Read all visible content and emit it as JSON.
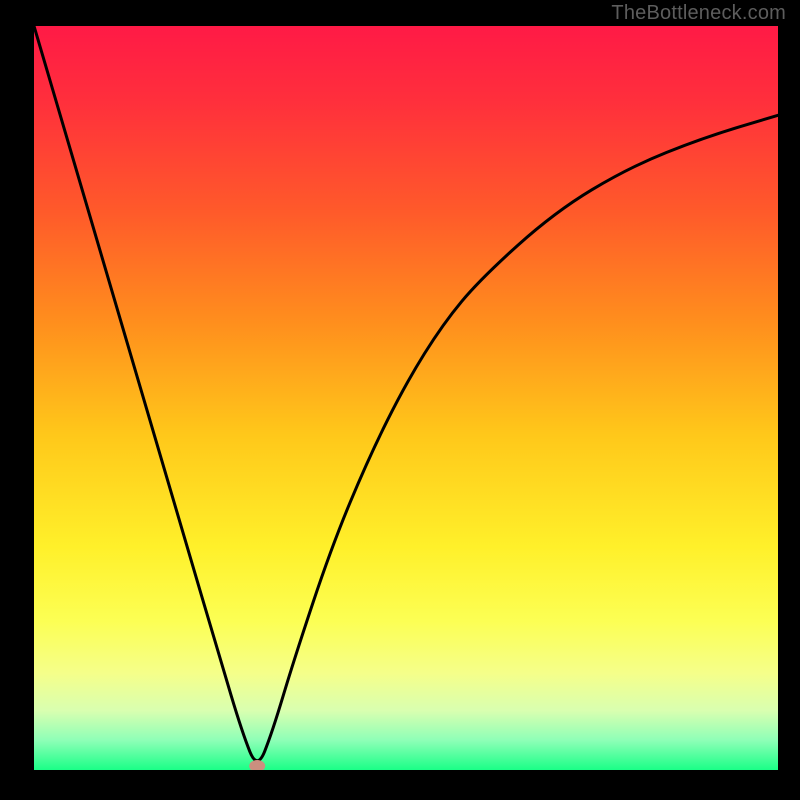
{
  "watermark": "TheBottleneck.com",
  "chart_data": {
    "type": "line",
    "title": "",
    "xlabel": "",
    "ylabel": "",
    "xlim": [
      0,
      1
    ],
    "ylim": [
      0,
      1
    ],
    "x": [
      0.0,
      0.05,
      0.1,
      0.15,
      0.2,
      0.25,
      0.28,
      0.3,
      0.32,
      0.35,
      0.4,
      0.45,
      0.5,
      0.55,
      0.6,
      0.7,
      0.8,
      0.9,
      1.0
    ],
    "values": [
      1.0,
      0.83,
      0.66,
      0.49,
      0.32,
      0.15,
      0.05,
      0.0,
      0.05,
      0.15,
      0.3,
      0.42,
      0.52,
      0.6,
      0.66,
      0.75,
      0.81,
      0.85,
      0.88
    ],
    "min_marker": {
      "x": 0.3,
      "y": 0.0
    },
    "gradient_stops": [
      {
        "offset": 0.0,
        "color": "#ff1a46"
      },
      {
        "offset": 0.1,
        "color": "#ff2f3c"
      },
      {
        "offset": 0.25,
        "color": "#ff5a2a"
      },
      {
        "offset": 0.4,
        "color": "#ff8f1d"
      },
      {
        "offset": 0.55,
        "color": "#ffc81a"
      },
      {
        "offset": 0.7,
        "color": "#fff02a"
      },
      {
        "offset": 0.8,
        "color": "#fcff54"
      },
      {
        "offset": 0.87,
        "color": "#f5ff8a"
      },
      {
        "offset": 0.92,
        "color": "#d9ffb0"
      },
      {
        "offset": 0.96,
        "color": "#8effb7"
      },
      {
        "offset": 1.0,
        "color": "#1aff87"
      }
    ]
  }
}
